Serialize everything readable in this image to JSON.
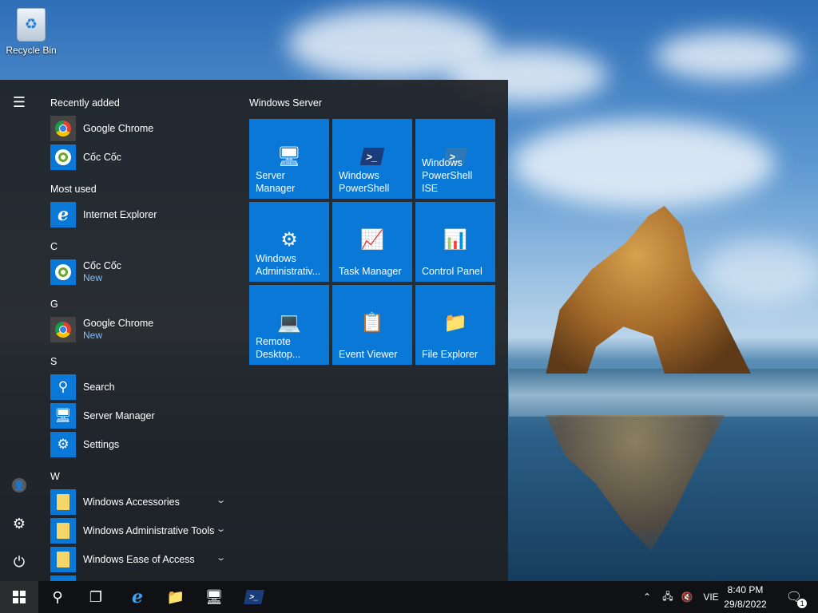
{
  "desktop": {
    "recycle_bin_label": "Recycle Bin"
  },
  "start_menu": {
    "sections": {
      "recently_added": "Recently added",
      "most_used": "Most used",
      "c": "C",
      "g": "G",
      "s": "S",
      "w": "W"
    },
    "apps": {
      "recent_chrome": {
        "name": "Google Chrome",
        "icon": "chrome-icon"
      },
      "recent_coccoc": {
        "name": "Cốc Cốc",
        "icon": "coccoc-icon"
      },
      "most_ie": {
        "name": "Internet Explorer",
        "icon": "internet-explorer-icon"
      },
      "c_coccoc": {
        "name": "Cốc Cốc",
        "badge": "New",
        "icon": "coccoc-icon"
      },
      "g_chrome": {
        "name": "Google Chrome",
        "badge": "New",
        "icon": "chrome-icon"
      },
      "s_search": {
        "name": "Search",
        "icon": "search-icon"
      },
      "s_server_manager": {
        "name": "Server Manager",
        "icon": "server-manager-icon"
      },
      "s_settings": {
        "name": "Settings",
        "icon": "gear-icon"
      },
      "w_accessories": {
        "name": "Windows Accessories",
        "icon": "folder-icon"
      },
      "w_admin_tools": {
        "name": "Windows Administrative Tools",
        "icon": "folder-icon"
      },
      "w_ease": {
        "name": "Windows Ease of Access",
        "icon": "folder-icon"
      }
    },
    "tiles_group_title": "Windows Server",
    "tiles": [
      {
        "label": "Server Manager",
        "icon": "server-manager-icon"
      },
      {
        "label": "Windows PowerShell",
        "icon": "powershell-icon"
      },
      {
        "label": "Windows PowerShell ISE",
        "icon": "powershell-ise-icon"
      },
      {
        "label": "Windows Administrativ...",
        "icon": "admin-tools-icon"
      },
      {
        "label": "Task Manager",
        "icon": "task-manager-icon"
      },
      {
        "label": "Control Panel",
        "icon": "control-panel-icon"
      },
      {
        "label": "Remote Desktop...",
        "icon": "remote-desktop-icon"
      },
      {
        "label": "Event Viewer",
        "icon": "event-viewer-icon"
      },
      {
        "label": "File Explorer",
        "icon": "folder-icon"
      }
    ]
  },
  "taskbar": {
    "language": "VIE",
    "time": "8:40 PM",
    "date": "29/8/2022",
    "notification_count": "1",
    "pinned": [
      "search-icon",
      "task-view-icon",
      "internet-explorer-icon",
      "file-explorer-icon",
      "server-manager-icon",
      "powershell-icon"
    ]
  },
  "colors": {
    "tile_blue": "#0a78d7",
    "start_bg": "#1f2125",
    "taskbar_bg": "#0f1114",
    "new_badge": "#86bdf5"
  }
}
